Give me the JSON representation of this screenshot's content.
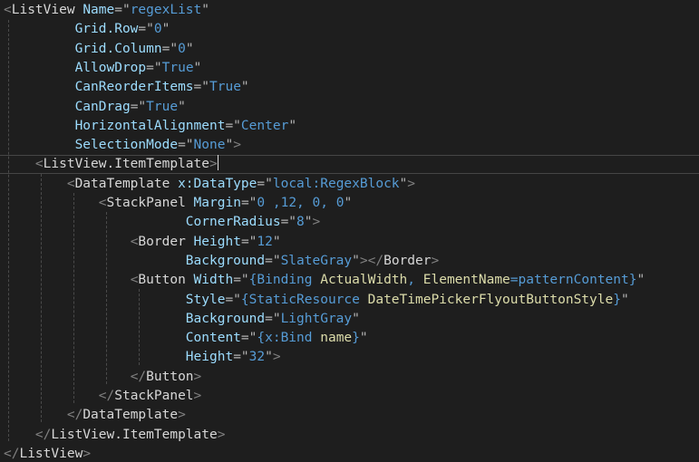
{
  "editor": {
    "lines": [
      {
        "indent": 0,
        "tokens": [
          {
            "t": "bracket",
            "v": "<"
          },
          {
            "t": "elem",
            "v": "ListView"
          },
          {
            "t": "text",
            "v": " "
          },
          {
            "t": "attr",
            "v": "Name"
          },
          {
            "t": "punc",
            "v": "=\""
          },
          {
            "t": "value",
            "v": "regexList"
          },
          {
            "t": "punc",
            "v": "\""
          }
        ]
      },
      {
        "indent": 9,
        "tokens": [
          {
            "t": "attr",
            "v": "Grid.Row"
          },
          {
            "t": "punc",
            "v": "=\""
          },
          {
            "t": "value",
            "v": "0"
          },
          {
            "t": "punc",
            "v": "\""
          }
        ]
      },
      {
        "indent": 9,
        "tokens": [
          {
            "t": "attr",
            "v": "Grid.Column"
          },
          {
            "t": "punc",
            "v": "=\""
          },
          {
            "t": "value",
            "v": "0"
          },
          {
            "t": "punc",
            "v": "\""
          }
        ]
      },
      {
        "indent": 9,
        "tokens": [
          {
            "t": "attr",
            "v": "AllowDrop"
          },
          {
            "t": "punc",
            "v": "=\""
          },
          {
            "t": "value",
            "v": "True"
          },
          {
            "t": "punc",
            "v": "\""
          }
        ]
      },
      {
        "indent": 9,
        "tokens": [
          {
            "t": "attr",
            "v": "CanReorderItems"
          },
          {
            "t": "punc",
            "v": "=\""
          },
          {
            "t": "value",
            "v": "True"
          },
          {
            "t": "punc",
            "v": "\""
          }
        ]
      },
      {
        "indent": 9,
        "tokens": [
          {
            "t": "attr",
            "v": "CanDrag"
          },
          {
            "t": "punc",
            "v": "=\""
          },
          {
            "t": "value",
            "v": "True"
          },
          {
            "t": "punc",
            "v": "\""
          }
        ]
      },
      {
        "indent": 9,
        "tokens": [
          {
            "t": "attr",
            "v": "HorizontalAlignment"
          },
          {
            "t": "punc",
            "v": "=\""
          },
          {
            "t": "value",
            "v": "Center"
          },
          {
            "t": "punc",
            "v": "\""
          }
        ]
      },
      {
        "indent": 9,
        "tokens": [
          {
            "t": "attr",
            "v": "SelectionMode"
          },
          {
            "t": "punc",
            "v": "=\""
          },
          {
            "t": "value",
            "v": "None"
          },
          {
            "t": "punc",
            "v": "\""
          },
          {
            "t": "bracket",
            "v": ">"
          }
        ]
      },
      {
        "indent": 4,
        "caret": true,
        "tokens": [
          {
            "t": "bracket",
            "v": "<"
          },
          {
            "t": "elem",
            "v": "ListView.ItemTemplate"
          },
          {
            "t": "bracket",
            "v": ">"
          }
        ]
      },
      {
        "indent": 8,
        "tokens": [
          {
            "t": "bracket",
            "v": "<"
          },
          {
            "t": "elem",
            "v": "DataTemplate"
          },
          {
            "t": "text",
            "v": " "
          },
          {
            "t": "attr",
            "v": "x:DataType"
          },
          {
            "t": "punc",
            "v": "=\""
          },
          {
            "t": "value",
            "v": "local:RegexBlock"
          },
          {
            "t": "punc",
            "v": "\""
          },
          {
            "t": "bracket",
            "v": ">"
          }
        ]
      },
      {
        "indent": 12,
        "tokens": [
          {
            "t": "bracket",
            "v": "<"
          },
          {
            "t": "elem",
            "v": "StackPanel"
          },
          {
            "t": "text",
            "v": " "
          },
          {
            "t": "attr",
            "v": "Margin"
          },
          {
            "t": "punc",
            "v": "=\""
          },
          {
            "t": "value",
            "v": "0 ,12, 0, 0"
          },
          {
            "t": "punc",
            "v": "\""
          }
        ]
      },
      {
        "indent": 23,
        "tokens": [
          {
            "t": "attr",
            "v": "CornerRadius"
          },
          {
            "t": "punc",
            "v": "=\""
          },
          {
            "t": "value",
            "v": "8"
          },
          {
            "t": "punc",
            "v": "\""
          },
          {
            "t": "bracket",
            "v": ">"
          }
        ]
      },
      {
        "indent": 16,
        "tokens": [
          {
            "t": "bracket",
            "v": "<"
          },
          {
            "t": "elem",
            "v": "Border"
          },
          {
            "t": "text",
            "v": " "
          },
          {
            "t": "attr",
            "v": "Height"
          },
          {
            "t": "punc",
            "v": "=\""
          },
          {
            "t": "value",
            "v": "12"
          },
          {
            "t": "punc",
            "v": "\""
          }
        ]
      },
      {
        "indent": 23,
        "tokens": [
          {
            "t": "attr",
            "v": "Background"
          },
          {
            "t": "punc",
            "v": "=\""
          },
          {
            "t": "value",
            "v": "SlateGray"
          },
          {
            "t": "punc",
            "v": "\""
          },
          {
            "t": "bracket",
            "v": "></"
          },
          {
            "t": "elem",
            "v": "Border"
          },
          {
            "t": "bracket",
            "v": ">"
          }
        ]
      },
      {
        "indent": 16,
        "tokens": [
          {
            "t": "bracket",
            "v": "<"
          },
          {
            "t": "elem",
            "v": "Button"
          },
          {
            "t": "text",
            "v": " "
          },
          {
            "t": "attr",
            "v": "Width"
          },
          {
            "t": "punc",
            "v": "=\""
          },
          {
            "t": "value",
            "v": "{"
          },
          {
            "t": "value",
            "v": "Binding"
          },
          {
            "t": "text",
            "v": " "
          },
          {
            "t": "ext",
            "v": "ActualWidth"
          },
          {
            "t": "value",
            "v": ", "
          },
          {
            "t": "ext",
            "v": "ElementName"
          },
          {
            "t": "value",
            "v": "="
          },
          {
            "t": "value",
            "v": "patternContent"
          },
          {
            "t": "value",
            "v": "}"
          },
          {
            "t": "punc",
            "v": "\""
          }
        ]
      },
      {
        "indent": 23,
        "tokens": [
          {
            "t": "attr",
            "v": "Style"
          },
          {
            "t": "punc",
            "v": "=\""
          },
          {
            "t": "value",
            "v": "{"
          },
          {
            "t": "value",
            "v": "StaticResource"
          },
          {
            "t": "text",
            "v": " "
          },
          {
            "t": "ext",
            "v": "DateTimePickerFlyoutButtonStyle"
          },
          {
            "t": "value",
            "v": "}"
          },
          {
            "t": "punc",
            "v": "\""
          }
        ]
      },
      {
        "indent": 23,
        "tokens": [
          {
            "t": "attr",
            "v": "Background"
          },
          {
            "t": "punc",
            "v": "=\""
          },
          {
            "t": "value",
            "v": "LightGray"
          },
          {
            "t": "punc",
            "v": "\""
          }
        ]
      },
      {
        "indent": 23,
        "tokens": [
          {
            "t": "attr",
            "v": "Content"
          },
          {
            "t": "punc",
            "v": "=\""
          },
          {
            "t": "value",
            "v": "{"
          },
          {
            "t": "value",
            "v": "x:Bind"
          },
          {
            "t": "text",
            "v": " "
          },
          {
            "t": "ext",
            "v": "name"
          },
          {
            "t": "value",
            "v": "}"
          },
          {
            "t": "punc",
            "v": "\""
          }
        ]
      },
      {
        "indent": 23,
        "tokens": [
          {
            "t": "attr",
            "v": "Height"
          },
          {
            "t": "punc",
            "v": "=\""
          },
          {
            "t": "value",
            "v": "32"
          },
          {
            "t": "punc",
            "v": "\""
          },
          {
            "t": "bracket",
            "v": ">"
          }
        ]
      },
      {
        "indent": 16,
        "tokens": [
          {
            "t": "bracket",
            "v": "</"
          },
          {
            "t": "elem",
            "v": "Button"
          },
          {
            "t": "bracket",
            "v": ">"
          }
        ]
      },
      {
        "indent": 12,
        "tokens": [
          {
            "t": "bracket",
            "v": "</"
          },
          {
            "t": "elem",
            "v": "StackPanel"
          },
          {
            "t": "bracket",
            "v": ">"
          }
        ]
      },
      {
        "indent": 8,
        "tokens": [
          {
            "t": "bracket",
            "v": "</"
          },
          {
            "t": "elem",
            "v": "DataTemplate"
          },
          {
            "t": "bracket",
            "v": ">"
          }
        ]
      },
      {
        "indent": 4,
        "tokens": [
          {
            "t": "bracket",
            "v": "</"
          },
          {
            "t": "elem",
            "v": "ListView.ItemTemplate"
          },
          {
            "t": "bracket",
            "v": ">"
          }
        ]
      },
      {
        "indent": 0,
        "tokens": [
          {
            "t": "bracket",
            "v": "</"
          },
          {
            "t": "elem",
            "v": "ListView"
          },
          {
            "t": "bracket",
            "v": ">"
          }
        ]
      }
    ]
  },
  "colors": {
    "background": "#1e1e1e",
    "bracket": "#808080",
    "element": "#d7d7d7",
    "attribute": "#9cdcfe",
    "value": "#569cd6",
    "markup_extension_arg": "#dcdcaa"
  }
}
